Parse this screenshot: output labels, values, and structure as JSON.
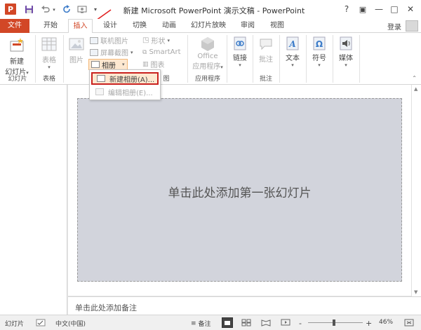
{
  "app": {
    "window_title": "新建 Microsoft PowerPoint 演示文稿 - PowerPoint",
    "logo_letter": "P",
    "login": "登录",
    "colors": {
      "accent": "#d24726",
      "highlight_border": "#c9211e",
      "slide_fill": "#d2d4dc"
    }
  },
  "quick_access": {
    "save_icon": "save-icon",
    "undo_icon": "undo-icon",
    "redo_icon": "redo-icon",
    "present_icon": "present-from-beginning-icon",
    "customize_icon": "customize-qat-icon"
  },
  "window_controls": {
    "help": "?",
    "ribbon_display": "▣",
    "minimize": "—",
    "maximize": "□",
    "close": "✕"
  },
  "tabs": [
    {
      "label": "文件"
    },
    {
      "label": "开始"
    },
    {
      "label": "插入"
    },
    {
      "label": "设计"
    },
    {
      "label": "切换"
    },
    {
      "label": "动画"
    },
    {
      "label": "幻灯片放映"
    },
    {
      "label": "审阅"
    },
    {
      "label": "视图"
    }
  ],
  "ribbon": {
    "slides": {
      "new_slide": "新建\n幻灯片",
      "new_slide_l1": "新建",
      "new_slide_l2": "幻灯片",
      "group": "幻灯片"
    },
    "tables": {
      "table": "表格",
      "group": "表格"
    },
    "images": {
      "pictures": "图片",
      "online_pictures": "联机图片",
      "screenshot": "屏幕截图",
      "album": "相册",
      "group_partial": "图"
    },
    "illustrations": {
      "shapes": "形状",
      "smartart": "SmartArt",
      "chart": "图表"
    },
    "apps": {
      "office_l1": "Office",
      "office_l2": "应用程序",
      "group": "应用程序"
    },
    "links": {
      "link": "链接"
    },
    "comments": {
      "comment": "批注",
      "group": "批注"
    },
    "text": {
      "text": "文本"
    },
    "symbols": {
      "symbol": "符号"
    },
    "media": {
      "media": "媒体"
    }
  },
  "album_menu": {
    "new_album": "新建相册(A)...",
    "edit_album": "编辑相册(E)..."
  },
  "slide": {
    "placeholder": "单击此处添加第一张幻灯片",
    "notes_placeholder": "单击此处添加备注"
  },
  "status": {
    "slide_label": "幻灯片",
    "language": "中文(中国)",
    "notes": "备注",
    "zoom_minus": "-",
    "zoom_plus": "+",
    "zoom": "46%"
  }
}
